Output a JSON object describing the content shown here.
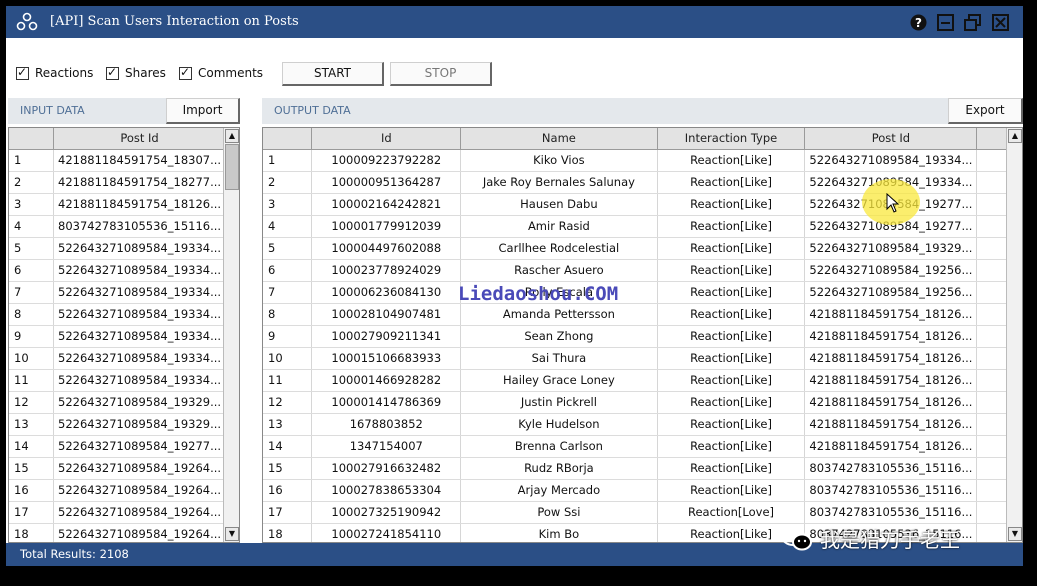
{
  "window": {
    "title": "[API] Scan Users Interaction on Posts",
    "app_icon": "share-network-icon",
    "controls": [
      {
        "name": "help",
        "icon": "question-circle-icon"
      },
      {
        "name": "minimize",
        "icon": "minimize-icon"
      },
      {
        "name": "restore",
        "icon": "restore-icon"
      },
      {
        "name": "close",
        "icon": "close-icon"
      }
    ]
  },
  "options": {
    "reactions": {
      "label": "Reactions",
      "checked": true
    },
    "shares": {
      "label": "Shares",
      "checked": true
    },
    "comments": {
      "label": "Comments",
      "checked": true
    }
  },
  "actions": {
    "start": "START",
    "stop": "STOP"
  },
  "input": {
    "section_label": "INPUT DATA",
    "import_label": "Import",
    "columns": [
      "",
      "Post Id"
    ],
    "rows": [
      [
        "1",
        "421881184591754_18307..."
      ],
      [
        "2",
        "421881184591754_18277..."
      ],
      [
        "3",
        "421881184591754_18126..."
      ],
      [
        "4",
        "803742783105536_15116..."
      ],
      [
        "5",
        "522643271089584_19334..."
      ],
      [
        "6",
        "522643271089584_19334..."
      ],
      [
        "7",
        "522643271089584_19334..."
      ],
      [
        "8",
        "522643271089584_19334..."
      ],
      [
        "9",
        "522643271089584_19334..."
      ],
      [
        "10",
        "522643271089584_19334..."
      ],
      [
        "11",
        "522643271089584_19334..."
      ],
      [
        "12",
        "522643271089584_19329..."
      ],
      [
        "13",
        "522643271089584_19329..."
      ],
      [
        "14",
        "522643271089584_19277..."
      ],
      [
        "15",
        "522643271089584_19264..."
      ],
      [
        "16",
        "522643271089584_19264..."
      ],
      [
        "17",
        "522643271089584_19264..."
      ],
      [
        "18",
        "522643271089584_19264..."
      ]
    ]
  },
  "output": {
    "section_label": "OUTPUT DATA",
    "export_label": "Export",
    "columns": [
      "",
      "Id",
      "Name",
      "Interaction Type",
      "Post Id",
      ""
    ],
    "rows": [
      [
        "1",
        "100009223792282",
        "Kiko Vios",
        "Reaction[Like]",
        "522643271089584_19334..."
      ],
      [
        "2",
        "100000951364287",
        "Jake Roy Bernales Salunay",
        "Reaction[Like]",
        "522643271089584_19334..."
      ],
      [
        "3",
        "100002164242821",
        "Hausen Dabu",
        "Reaction[Like]",
        "522643271089584_19277..."
      ],
      [
        "4",
        "100001779912039",
        "Amir Rasid",
        "Reaction[Like]",
        "522643271089584_19277..."
      ],
      [
        "5",
        "100004497602088",
        "Carllhee Rodcelestial",
        "Reaction[Like]",
        "522643271089584_19329..."
      ],
      [
        "6",
        "100023778924029",
        "Rascher Asuero",
        "Reaction[Like]",
        "522643271089584_19256..."
      ],
      [
        "7",
        "100006236084130",
        "Rolly Escala",
        "Reaction[Like]",
        "522643271089584_19256..."
      ],
      [
        "8",
        "100028104907481",
        "Amanda Pettersson",
        "Reaction[Like]",
        "421881184591754_18126..."
      ],
      [
        "9",
        "100027909211341",
        "Sean Zhong",
        "Reaction[Like]",
        "421881184591754_18126..."
      ],
      [
        "10",
        "100015106683933",
        "Sai Thura",
        "Reaction[Like]",
        "421881184591754_18126..."
      ],
      [
        "11",
        "100001466928282",
        "Hailey Grace Loney",
        "Reaction[Like]",
        "421881184591754_18126..."
      ],
      [
        "12",
        "100001414786369",
        "Justin Pickrell",
        "Reaction[Like]",
        "421881184591754_18126..."
      ],
      [
        "13",
        "1678803852",
        "Kyle Hudelson",
        "Reaction[Like]",
        "421881184591754_18126..."
      ],
      [
        "14",
        "1347154007",
        "Brenna Carlson",
        "Reaction[Like]",
        "421881184591754_18126..."
      ],
      [
        "15",
        "100027916632482",
        "Rudz RBorja",
        "Reaction[Like]",
        "803742783105536_15116..."
      ],
      [
        "16",
        "100027838653304",
        "Arjay Mercado",
        "Reaction[Like]",
        "803742783105536_15116..."
      ],
      [
        "17",
        "100027325190942",
        "Pow Ssi",
        "Reaction[Love]",
        "803742783105536_15116..."
      ],
      [
        "18",
        "100027241854110",
        "Kim Bo",
        "Reaction[Like]",
        "803742783105536_15116..."
      ]
    ]
  },
  "status": {
    "total_results": "Total Results: 2108"
  },
  "overlay": {
    "watermark": "Liedaoshou.COM",
    "wechat_label": "我是猎刀手老王"
  }
}
